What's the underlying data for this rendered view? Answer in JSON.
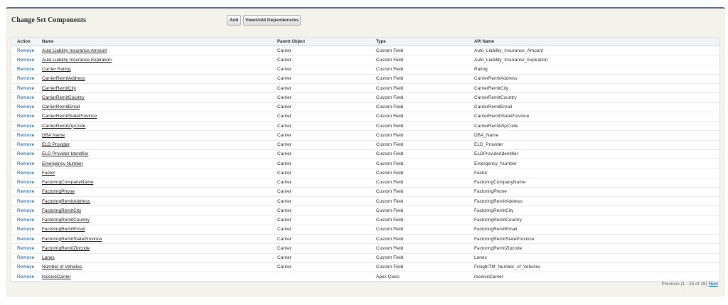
{
  "panel": {
    "title": "Change Set Components",
    "add_label": "Add",
    "deps_label": "View/Add Dependencies"
  },
  "table": {
    "headers": {
      "action": "Action",
      "name": "Name",
      "parent": "Parent Object",
      "type": "Type",
      "api": "API Name"
    },
    "rows": [
      {
        "action": "Remove",
        "name": "Auto Liability Insurance Amount",
        "parent": "Carrier",
        "type": "Custom Field",
        "api": "Auto_Liability_Insurance_Amount"
      },
      {
        "action": "Remove",
        "name": "Auto Liability Insurance Expiration",
        "parent": "Carrier",
        "type": "Custom Field",
        "api": "Auto_Liability_Insurance_Expiration"
      },
      {
        "action": "Remove",
        "name": "Carrier Rating",
        "parent": "Carrier",
        "type": "Custom Field",
        "api": "Rating"
      },
      {
        "action": "Remove",
        "name": "CarrierRemitAddress",
        "parent": "Carrier",
        "type": "Custom Field",
        "api": "CarrierRemitAddress"
      },
      {
        "action": "Remove",
        "name": "CarrierRemitCity",
        "parent": "Carrier",
        "type": "Custom Field",
        "api": "CarrierRemitCity"
      },
      {
        "action": "Remove",
        "name": "CarrierRemitCountry",
        "parent": "Carrier",
        "type": "Custom Field",
        "api": "CarrierRemitCountry"
      },
      {
        "action": "Remove",
        "name": "CarrierRemitEmail",
        "parent": "Carrier",
        "type": "Custom Field",
        "api": "CarrierRemitEmail"
      },
      {
        "action": "Remove",
        "name": "CarrierRemitStateProvince",
        "parent": "Carrier",
        "type": "Custom Field",
        "api": "CarrierRemitStateProvince"
      },
      {
        "action": "Remove",
        "name": "CarrierRemitZipCode",
        "parent": "Carrier",
        "type": "Custom Field",
        "api": "CarrierRemitZipCode"
      },
      {
        "action": "Remove",
        "name": "DBA Name",
        "parent": "Carrier",
        "type": "Custom Field",
        "api": "DBA_Name"
      },
      {
        "action": "Remove",
        "name": "ELD Provider",
        "parent": "Carrier",
        "type": "Custom Field",
        "api": "ELD_Provider"
      },
      {
        "action": "Remove",
        "name": "ELD Provider Identifier",
        "parent": "Carrier",
        "type": "Custom Field",
        "api": "ELDProviderIdentifier"
      },
      {
        "action": "Remove",
        "name": "Emergency Number",
        "parent": "Carrier",
        "type": "Custom Field",
        "api": "Emergency_Number"
      },
      {
        "action": "Remove",
        "name": "Factor",
        "parent": "Carrier",
        "type": "Custom Field",
        "api": "Factor"
      },
      {
        "action": "Remove",
        "name": "FactoringCompanyName",
        "parent": "Carrier",
        "type": "Custom Field",
        "api": "FactoringCompanyName"
      },
      {
        "action": "Remove",
        "name": "FactoringPhone",
        "parent": "Carrier",
        "type": "Custom Field",
        "api": "FactoringPhone"
      },
      {
        "action": "Remove",
        "name": "FactoringRemitAddress",
        "parent": "Carrier",
        "type": "Custom Field",
        "api": "FactoringRemitAddress"
      },
      {
        "action": "Remove",
        "name": "FactoringRemitCity",
        "parent": "Carrier",
        "type": "Custom Field",
        "api": "FactoringRemitCity"
      },
      {
        "action": "Remove",
        "name": "FactoringRemitCountry",
        "parent": "Carrier",
        "type": "Custom Field",
        "api": "FactoringRemitCountry"
      },
      {
        "action": "Remove",
        "name": "FactoringRemitEmail",
        "parent": "Carrier",
        "type": "Custom Field",
        "api": "FactoringRemitEmail"
      },
      {
        "action": "Remove",
        "name": "FactoringRemitStateProvince",
        "parent": "Carrier",
        "type": "Custom Field",
        "api": "FactoringRemitStateProvince"
      },
      {
        "action": "Remove",
        "name": "FactoringRemitZipcode",
        "parent": "Carrier",
        "type": "Custom Field",
        "api": "FactoringRemitZipcode"
      },
      {
        "action": "Remove",
        "name": "Lanes",
        "parent": "Carrier",
        "type": "Custom Field",
        "api": "Lanes"
      },
      {
        "action": "Remove",
        "name": "Number of Vehicles",
        "parent": "Carrier",
        "type": "Custom Field",
        "api": "FreightTM_Number_of_Vehicles"
      },
      {
        "action": "Remove",
        "name": "receiveCarrier",
        "parent": "",
        "type": "Apex Class",
        "api": "receiveCarrier"
      }
    ]
  },
  "pager": {
    "text": "Previous (1 - 25 of 26)",
    "next_label": "Next"
  }
}
